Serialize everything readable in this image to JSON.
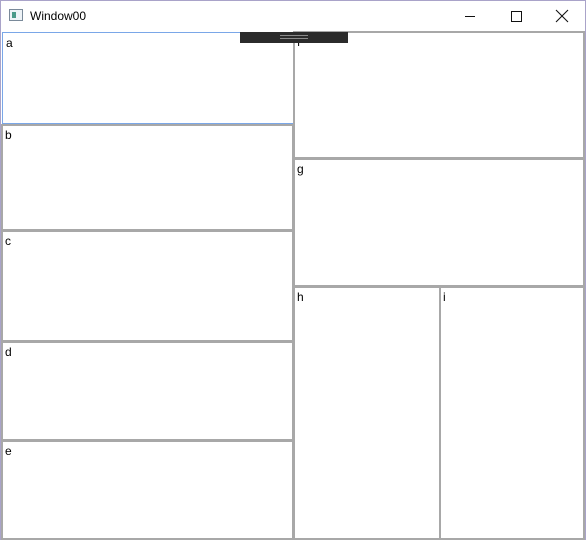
{
  "window": {
    "title": "Window00",
    "controls": {
      "minimize": "minimize-icon",
      "maximize": "maximize-icon",
      "close": "close-icon"
    }
  },
  "panes": {
    "a": "a",
    "b": "b",
    "c": "c",
    "d": "d",
    "e": "e",
    "f": "f",
    "g": "g",
    "h": "h",
    "i": "i"
  },
  "colors": {
    "window_border": "#a9a3c9",
    "pane_border": "#a8a8a8",
    "selected_border": "#7aa7e8",
    "drag_handle": "#2b2b2b"
  }
}
